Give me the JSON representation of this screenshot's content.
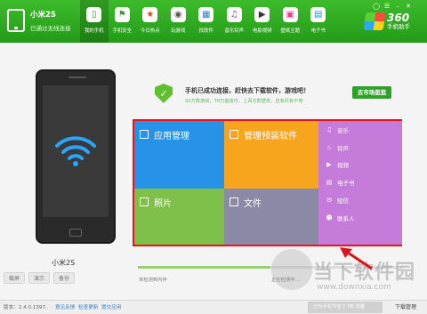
{
  "device": {
    "name": "小米2S",
    "status": "已通过无线连接"
  },
  "nav": [
    {
      "label": "我的手机",
      "icon": "phone-icon",
      "active": true
    },
    {
      "label": "手机安全",
      "icon": "shield-icon"
    },
    {
      "label": "今日热点",
      "icon": "star-icon"
    },
    {
      "label": "玩游戏",
      "icon": "gamepad-icon"
    },
    {
      "label": "找软件",
      "icon": "apps-icon"
    },
    {
      "label": "音乐铃声",
      "icon": "music-icon"
    },
    {
      "label": "电影视频",
      "icon": "video-icon"
    },
    {
      "label": "壁纸主题",
      "icon": "wallpaper-icon"
    },
    {
      "label": "电子书",
      "icon": "book-icon"
    }
  ],
  "logo": {
    "big": "360",
    "small": "手机助手"
  },
  "banner": {
    "title": "手机已成功连接，赶快去下载软件，游戏吧！",
    "subtitle": "50万款游戏，70万首音乐，上百万款壁纸，应有尽有不停",
    "button": "去市场逛逛"
  },
  "tiles": {
    "apps": "应用管理",
    "preinstalled": "管理预装软件",
    "photos": "照片",
    "files": "文件"
  },
  "menu": [
    "音乐",
    "铃声",
    "视频",
    "电子书",
    "短信",
    "联系人"
  ],
  "phone_model": "小米2S",
  "left_buttons": [
    "截屏",
    "演示",
    "备份"
  ],
  "progress": {
    "left": "未检测到内存",
    "right": "正在检测中…",
    "value": 0.5
  },
  "footer": {
    "version": "版本：2.4.0.1397",
    "links": [
      "意见反馈",
      "检查更新",
      "提交应用"
    ],
    "download_status": "已为手机节省了 0B 流量",
    "download_manager": "下载管理"
  },
  "watermark": {
    "text": "当下软件园",
    "url": "www.downxia.com"
  },
  "colors": {
    "header": "#2da129",
    "highlight": "#e8111c"
  }
}
